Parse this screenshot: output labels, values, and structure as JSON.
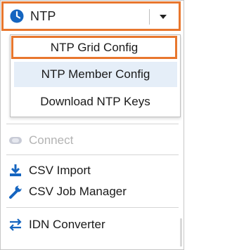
{
  "split_button": {
    "label": "NTP",
    "icon": "clock-icon",
    "accent": "#1565c0"
  },
  "dropdown": {
    "items": [
      {
        "label": "NTP Grid Config"
      },
      {
        "label": "NTP Member Config"
      },
      {
        "label": "Download NTP Keys"
      }
    ]
  },
  "panel": {
    "connect_label": "Connect",
    "csv_import_label": "CSV Import",
    "csv_job_manager_label": "CSV Job Manager",
    "idn_converter_label": "IDN Converter"
  },
  "colors": {
    "focus_outline": "#e8772e",
    "hover_bg": "#e5eef8",
    "icon_blue": "#1565c0"
  }
}
